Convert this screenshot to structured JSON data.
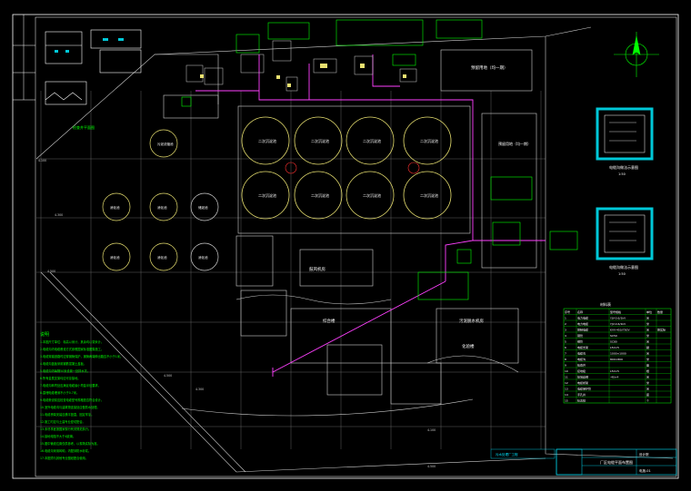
{
  "drawing": {
    "tank_labels": [
      "二次沉淀池",
      "二次沉淀池",
      "二次沉淀池",
      "二次沉淀池",
      "二次沉淀池",
      "二次沉淀池",
      "二次沉淀池",
      "二次沉淀池"
    ],
    "left_tank_labels": [
      "污泥浓缩池",
      "消化池",
      "消化池",
      "储泥池",
      "消化池",
      "消化池",
      "消化池"
    ],
    "buildings": {
      "storage_top": "预留用地（均一期）",
      "storage_mid": "预留用地（均一期）",
      "aeration": "鼓风机房",
      "admin": "综合楼",
      "sludge": "污泥脱水机房",
      "lab": "化验楼"
    },
    "detail_titles": [
      "电缆沟做法示意图",
      "电缆沟做法示意图"
    ],
    "detail_scale": "1:50",
    "left_detail_title": "检查井平面图",
    "notes_title": "说明",
    "notes": [
      "1.本图尺寸单位：标高以米计，其余均以毫米计。",
      "2.电缆沟内电缆敷设方式参照国家标准图集施工。",
      "3.电缆穿越道路时应穿钢管保护，钢管两端伸出路边不小于1米。",
      "4.电缆沟盖板采用钢筋混凝土盖板。",
      "5.电缆沟内每隔50米设置一处排水坑。",
      "6.所有金属支架均应可靠接地。",
      "7.电缆沟转弯处应满足电缆最小弯曲半径要求。",
      "8.直埋电缆埋深不小于0.7米。",
      "9.电缆敷设前应检查电缆型号规格是否符合设计。",
      "10.室外电缆沟与建筑物连接处应做防水处理。",
      "11.电缆桥架安装应横平竖直，固定牢靠。",
      "12.施工时应与土建专业密切配合。",
      "13.未尽事宜按国家现行有关规范执行。",
      "14.接地电阻不大于4欧姆。",
      "15.图中管线位置仅供参考，以现场实际为准。",
      "16.电缆沟采用砖砌，内壁抹防水砂浆。",
      "17.本图须与其他专业图纸配合使用。"
    ],
    "legend": {
      "title": "材料表",
      "headers": [
        "序号",
        "名称",
        "型号规格",
        "单位",
        "数量"
      ],
      "rows": [
        [
          "1",
          "电力电缆",
          "YJV-0.6/1kV",
          "米",
          ""
        ],
        [
          "2",
          "电力电缆",
          "YJV-0.6/1kV",
          "米",
          ""
        ],
        [
          "3",
          "控制电缆",
          "KVV-450/750V",
          "米",
          "按实际"
        ],
        [
          "4",
          "钢管",
          "SC50",
          "米",
          ""
        ],
        [
          "5",
          "钢管",
          "SC80",
          "米",
          ""
        ],
        [
          "6",
          "电缆支架",
          "L50×5",
          "副",
          ""
        ],
        [
          "7",
          "电缆沟",
          "1000×1000",
          "米",
          ""
        ],
        [
          "8",
          "电缆沟",
          "800×800",
          "米",
          ""
        ],
        [
          "9",
          "检查井",
          "",
          "座",
          ""
        ],
        [
          "10",
          "接地极",
          "L50×5",
          "根",
          ""
        ],
        [
          "11",
          "接地扁钢",
          "-40×4",
          "米",
          ""
        ],
        [
          "12",
          "电缆桥架",
          "",
          "米",
          ""
        ],
        [
          "13",
          "电缆保护管",
          "",
          "米",
          ""
        ],
        [
          "14",
          "手孔井",
          "",
          "座",
          ""
        ],
        [
          "15",
          "标志桩",
          "",
          "个",
          ""
        ]
      ]
    },
    "title_block": {
      "project": "污水处理厂工程",
      "drawing_name": "厂区电缆平面布置图",
      "company": "设计院",
      "drawing_no": "电施-01"
    },
    "elevations": [
      "4.100",
      "4.300",
      "4.500",
      "4.500",
      "4.300",
      "4.100",
      "4.500"
    ],
    "colors": {
      "background": "#000000",
      "frame": "#ffffff",
      "structure": "#d0d0d0",
      "green_text": "#00ff00",
      "tank_circle": "#e8e070",
      "cable": "#ff40ff",
      "border_cyan": "#00e5ff",
      "detail_fill": "#00c8d8"
    }
  }
}
